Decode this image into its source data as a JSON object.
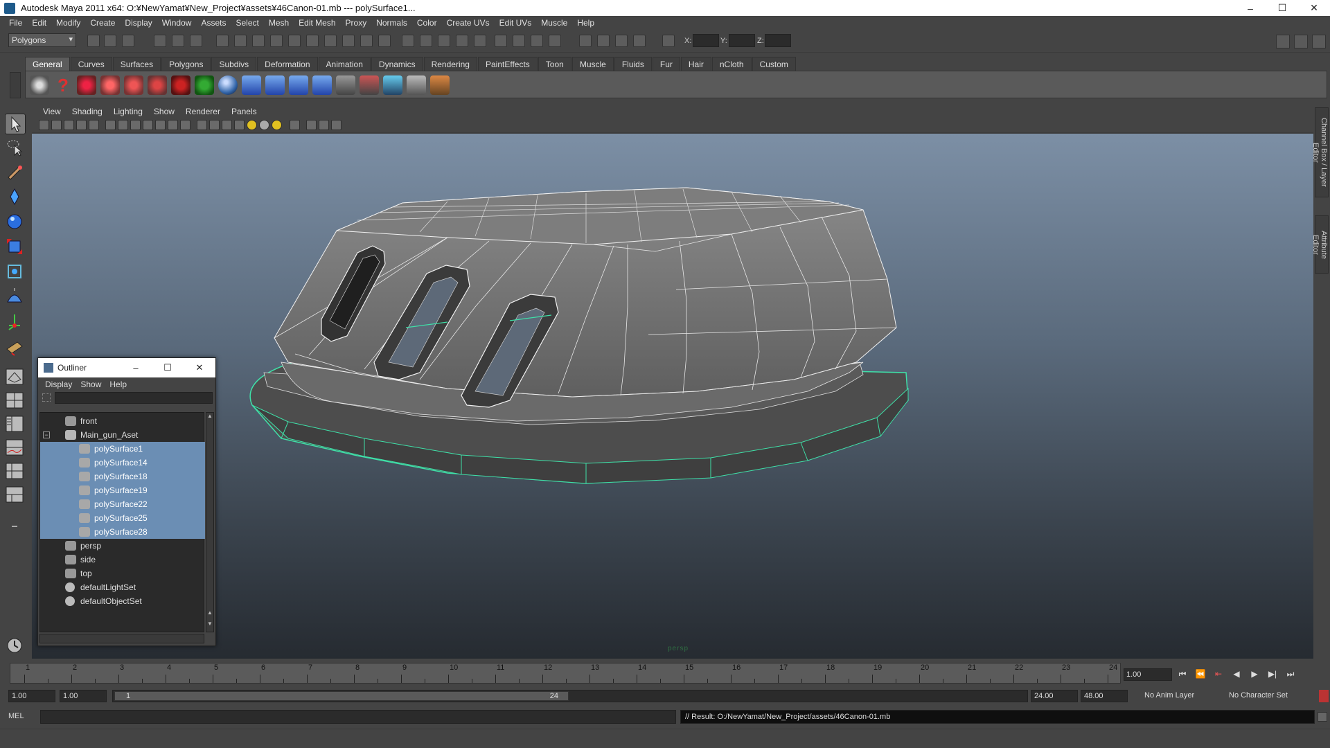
{
  "window": {
    "title": "Autodesk Maya 2011 x64: O:¥NewYamat¥New_Project¥assets¥46Canon-01.mb   ---   polySurface1...",
    "minimize": "–",
    "maximize": "☐",
    "close": "✕"
  },
  "menubar": [
    "File",
    "Edit",
    "Modify",
    "Create",
    "Display",
    "Window",
    "Assets",
    "Select",
    "Mesh",
    "Edit Mesh",
    "Proxy",
    "Normals",
    "Color",
    "Create UVs",
    "Edit UVs",
    "Muscle",
    "Help"
  ],
  "statusline": {
    "mode": "Polygons",
    "x_label": "X:",
    "y_label": "Y:",
    "z_label": "Z:"
  },
  "shelf": {
    "tabs": [
      "General",
      "Curves",
      "Surfaces",
      "Polygons",
      "Subdivs",
      "Deformation",
      "Animation",
      "Dynamics",
      "Rendering",
      "PaintEffects",
      "Toon",
      "Muscle",
      "Fluids",
      "Fur",
      "Hair",
      "nCloth",
      "Custom"
    ],
    "active_tab": "General",
    "icons": [
      "hypershade-icon",
      "help-icon",
      "sculpt-icon",
      "paint-weights-icon",
      "paint-effects-icon",
      "artisan-icon",
      "magnet-icon",
      "snap-icon",
      "sphere-icon",
      "joint-icon",
      "ik-icon",
      "ik-spline-icon",
      "skin-icon",
      "lattice-icon",
      "cluster-icon",
      "blend-icon",
      "render-icon",
      "paint-icon"
    ]
  },
  "viewport": {
    "menu": [
      "View",
      "Shading",
      "Lighting",
      "Show",
      "Renderer",
      "Panels"
    ],
    "camera": "persp",
    "bg_top": "#7c8fa5",
    "bg_bottom": "#262b31",
    "wire_color": "#ffffff",
    "selection_color": "#3fe0a8"
  },
  "right_tabs": [
    "Channel Box / Layer Editor",
    "Attribute Editor"
  ],
  "outliner": {
    "title": "Outliner",
    "menu": [
      "Display",
      "Show",
      "Help"
    ],
    "rows": [
      {
        "label": "front",
        "type": "camera",
        "indent": 0,
        "selected": false
      },
      {
        "label": "Main_gun_Aset",
        "type": "group",
        "indent": 0,
        "selected": false,
        "expanded": true
      },
      {
        "label": "polySurface1",
        "type": "mesh",
        "indent": 1,
        "selected": true
      },
      {
        "label": "polySurface14",
        "type": "mesh",
        "indent": 1,
        "selected": true
      },
      {
        "label": "polySurface18",
        "type": "mesh",
        "indent": 1,
        "selected": true
      },
      {
        "label": "polySurface19",
        "type": "mesh",
        "indent": 1,
        "selected": true
      },
      {
        "label": "polySurface22",
        "type": "mesh",
        "indent": 1,
        "selected": true
      },
      {
        "label": "polySurface25",
        "type": "mesh",
        "indent": 1,
        "selected": true
      },
      {
        "label": "polySurface28",
        "type": "mesh",
        "indent": 1,
        "selected": true
      },
      {
        "label": "persp",
        "type": "camera",
        "indent": 0,
        "selected": false
      },
      {
        "label": "side",
        "type": "camera",
        "indent": 0,
        "selected": false
      },
      {
        "label": "top",
        "type": "camera",
        "indent": 0,
        "selected": false
      },
      {
        "label": "defaultLightSet",
        "type": "set",
        "indent": 0,
        "selected": false
      },
      {
        "label": "defaultObjectSet",
        "type": "set",
        "indent": 0,
        "selected": false
      }
    ]
  },
  "timeline": {
    "ticks": [
      "1",
      "2",
      "3",
      "4",
      "5",
      "6",
      "7",
      "8",
      "9",
      "10",
      "11",
      "12",
      "13",
      "14",
      "15",
      "16",
      "17",
      "18",
      "19",
      "20",
      "21",
      "22",
      "23",
      "24"
    ],
    "current_frame": "1.00",
    "playback": [
      "⏮",
      "⏪",
      "⇤",
      "◀",
      "▶",
      "▶|",
      "⏭"
    ]
  },
  "range": {
    "start_time": "1.00",
    "playback_start": "1.00",
    "range_start": "1",
    "range_end": "24",
    "playback_end": "24.00",
    "end_time": "48.00",
    "anim_layer": "No Anim Layer",
    "character_set": "No Character Set"
  },
  "command": {
    "label": "MEL",
    "result": "// Result: O:/NewYamat/New_Project/assets/46Canon-01.mb"
  }
}
